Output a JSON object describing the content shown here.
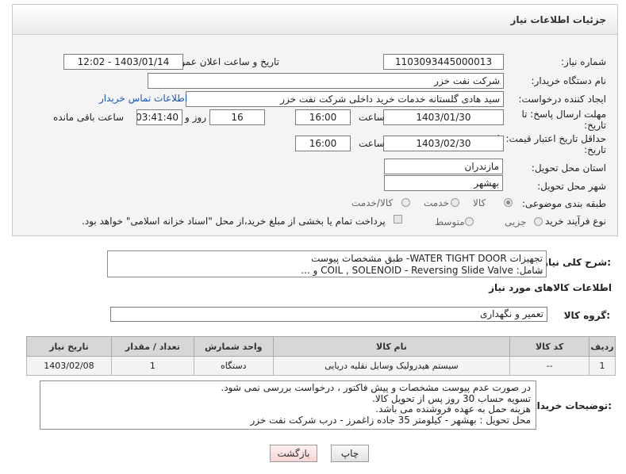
{
  "header": {
    "title": "جزئیات اطلاعات نیاز"
  },
  "fields": {
    "need_number_label": "شماره نیاز:",
    "need_number": "1103093445000013",
    "announce_label": "تاریخ و ساعت اعلان عمومی:",
    "announce_value": "1403/01/14 - 12:02",
    "buyer_org_label": "نام دستگاه خریدار:",
    "buyer_org": "شرکت نفت خزر",
    "creator_label": "ایجاد کننده درخواست:",
    "creator": "سید هادی گلستانه خدمات خرید داخلی شرکت نفت خزر",
    "buyer_contact_link": "اطلاعات تماس خریدار",
    "reply_deadline_label_1": "مهلت ارسال پاسخ: تا",
    "reply_deadline_label_2": "تاریخ:",
    "reply_date": "1403/01/30",
    "time_label": "ساعت",
    "reply_time": "16:00",
    "days_value": "16",
    "days_label": "روز و",
    "remaining_value": "03:41:40",
    "remaining_label": "ساعت باقی مانده",
    "validity_label_1": "حداقل تاریخ اعتبار قیمت: تا",
    "validity_label_2": "تاریخ:",
    "validity_date": "1403/02/30",
    "validity_time_label": "ساعت",
    "validity_time": "16:00",
    "province_label": "استان محل تحویل:",
    "province": "مازندران",
    "city_label": "شهر محل تحویل:",
    "city": "بهشهر",
    "category_label": "طبقه بندی موضوعی:",
    "category_options": [
      "کالا",
      "خدمت",
      "کالا/خدمت"
    ],
    "purchase_type_label": "نوع فرآیند خرید :",
    "purchase_options": [
      "جزیی",
      "متوسط"
    ],
    "purchase_note": "پرداخت تمام یا بخشی از مبلغ خرید،از محل \"اسناد خزانه اسلامی\" خواهد بود."
  },
  "description": {
    "label": "شرح کلی نیاز:",
    "line1": "تجهیزات WATER TIGHT DOOR- طبق مشخصات پیوست",
    "line2": "شامل: COIL , SOLENOID - Reversing Slide Valve و ..."
  },
  "goods_info": {
    "title": "اطلاعات کالاهای مورد نیاز",
    "group_label": "گروه کالا:",
    "group_value": "تعمیر و نگهداری"
  },
  "table": {
    "headers": [
      "ردیف",
      "کد کالا",
      "نام کالا",
      "واحد شمارش",
      "تعداد / مقدار",
      "تاریخ نیاز"
    ],
    "rows": [
      [
        "1",
        "--",
        "سیستم هیدرولیک وسایل نقلیه دریایی",
        "دستگاه",
        "1",
        "1403/02/08"
      ]
    ]
  },
  "notes": {
    "label": "توضیحات خریدار:",
    "lines": [
      "در صورت عدم پیوست مشخصات و پیش فاکتور ، درخواست بررسی نمی شود.",
      "تسویه حساب 30 روز پس از تحویل کالا.",
      "هزینه حمل به عهده فروشنده می باشد.",
      "محل تحویل : بهشهر - کیلومتر 35 جاده زاغمرز - درب شرکت نفت خزر"
    ]
  },
  "buttons": {
    "print": "چاپ",
    "back": "بازگشت"
  }
}
